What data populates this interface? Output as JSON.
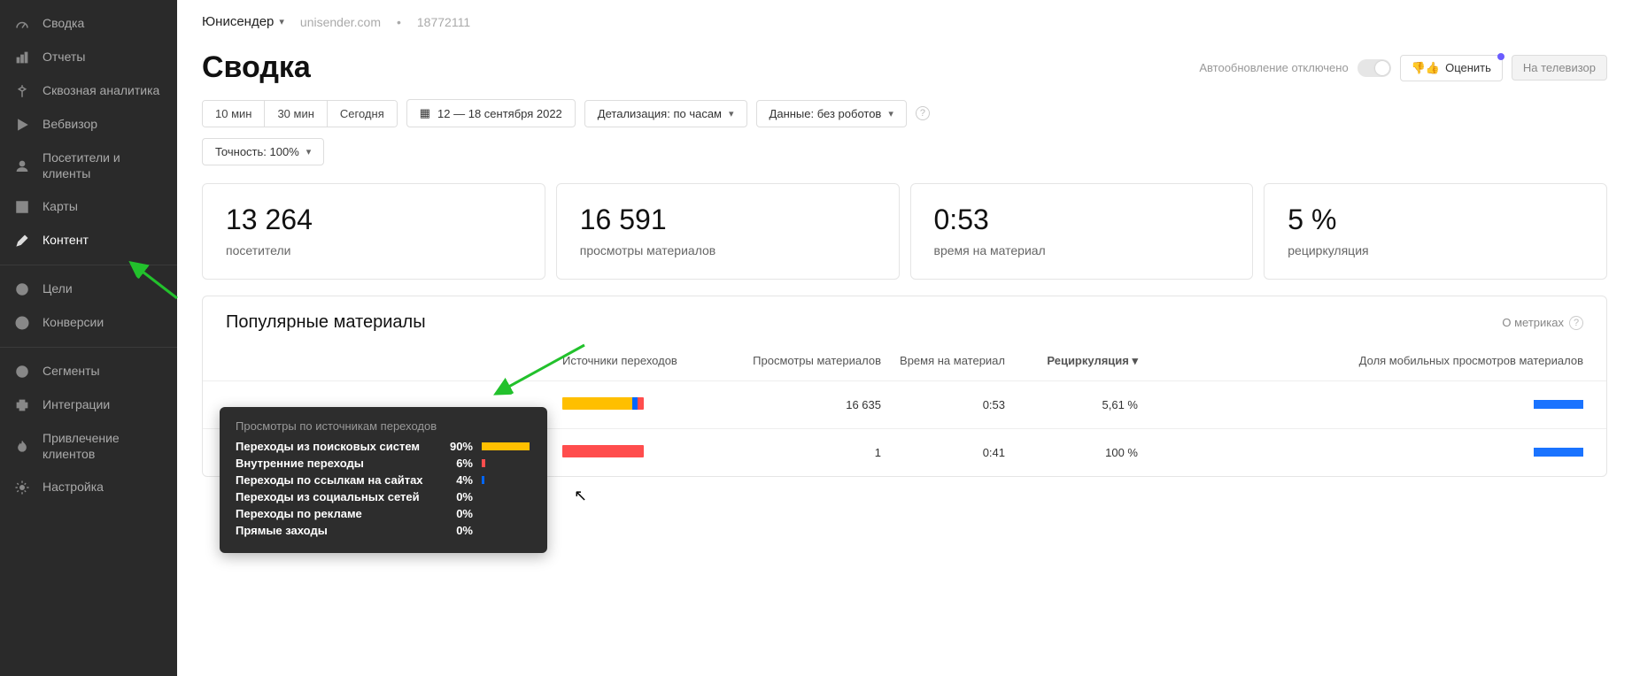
{
  "sidebar": {
    "items": [
      {
        "label": "Сводка"
      },
      {
        "label": "Отчеты"
      },
      {
        "label": "Сквозная аналитика"
      },
      {
        "label": "Вебвизор"
      },
      {
        "label": "Посетители и клиенты"
      },
      {
        "label": "Карты"
      },
      {
        "label": "Контент"
      },
      {
        "label": "Цели"
      },
      {
        "label": "Конверсии"
      },
      {
        "label": "Сегменты"
      },
      {
        "label": "Интеграции"
      },
      {
        "label": "Привлечение клиентов"
      },
      {
        "label": "Настройка"
      }
    ]
  },
  "header": {
    "brand": "Юнисендер",
    "domain": "unisender.com",
    "counter_id": "18772111"
  },
  "page": {
    "title": "Сводка",
    "autorefresh_label": "Автообновление отключено",
    "rate_btn": "Оценить",
    "tv_btn": "На телевизор"
  },
  "filters": {
    "range_10min": "10 мин",
    "range_30min": "30 мин",
    "range_today": "Сегодня",
    "date_range": "12 — 18 сентября 2022",
    "detail_label": "Детализация: по часам",
    "data_label": "Данные: без роботов",
    "accuracy_label": "Точность: 100%"
  },
  "metrics": [
    {
      "value": "13 264",
      "label": "посетители"
    },
    {
      "value": "16 591",
      "label": "просмотры материалов"
    },
    {
      "value": "0:53",
      "label": "время на материал"
    },
    {
      "value": "5 %",
      "label": "рециркуляция"
    }
  ],
  "popular": {
    "title": "Популярные материалы",
    "about_metrics": "О метриках",
    "columns": {
      "sources": "Источники переходов",
      "views": "Просмотры материалов",
      "time": "Время на материал",
      "recirc": "Рециркуляция ▾",
      "mobile": "Доля мобильных просмотров материалов"
    },
    "rows": [
      {
        "views": "16 635",
        "time": "0:53",
        "recirc": "5,61 %",
        "src_bar": [
          {
            "color": "#ffbf00",
            "pct": 86
          },
          {
            "color": "#0066ff",
            "pct": 6
          },
          {
            "color": "#ff4d4d",
            "pct": 8
          }
        ]
      },
      {
        "views": "1",
        "time": "0:41",
        "recirc": "100 %",
        "src_bar": [
          {
            "color": "#ff4d4d",
            "pct": 100
          }
        ]
      }
    ]
  },
  "tooltip": {
    "title": "Просмотры по источникам переходов",
    "rows": [
      {
        "name": "Переходы из поисковых систем",
        "pct": "90%",
        "color": "#ffbf00",
        "w": 54
      },
      {
        "name": "Внутренние переходы",
        "pct": "6%",
        "color": "#ff4d4d",
        "w": 4
      },
      {
        "name": "Переходы по ссылкам на сайтах",
        "pct": "4%",
        "color": "#0066ff",
        "w": 3
      },
      {
        "name": "Переходы из социальных сетей",
        "pct": "0%",
        "color": "#888",
        "w": 0
      },
      {
        "name": "Переходы по рекламе",
        "pct": "0%",
        "color": "#888",
        "w": 0
      },
      {
        "name": "Прямые заходы",
        "pct": "0%",
        "color": "#888",
        "w": 0
      }
    ]
  }
}
